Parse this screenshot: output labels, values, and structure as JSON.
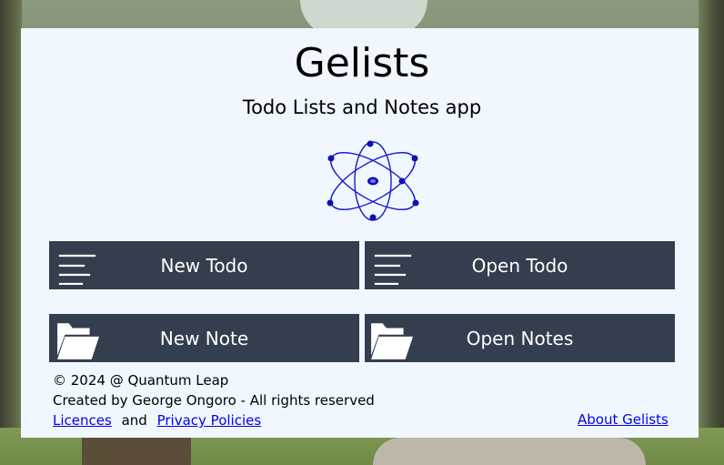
{
  "app": {
    "title": "Gelists",
    "subtitle": "Todo Lists and Notes app"
  },
  "buttons": {
    "new_todo": "New Todo",
    "open_todo": "Open Todo",
    "new_note": "New Note",
    "open_notes": "Open Notes"
  },
  "footer": {
    "copyright": "© 2024 @ Quantum Leap",
    "created_by": "Created by George Ongoro - All rights reserved",
    "licences": "Licences",
    "and": "and",
    "privacy": "Privacy Policies",
    "about": "About Gelists"
  },
  "icons": {
    "logo": "atom-icon",
    "todo": "menu-lines-icon",
    "note": "folder-open-icon"
  },
  "colors": {
    "card_bg": "#f0f7ff",
    "button_bg": "#333e4e",
    "button_text": "#ffffff",
    "atom": "#1a1acc",
    "link": "#0000ee"
  }
}
